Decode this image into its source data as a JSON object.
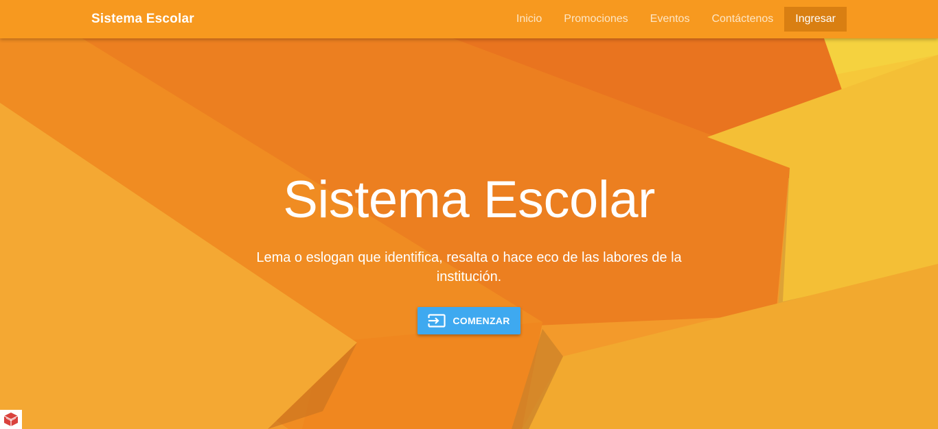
{
  "navbar": {
    "brand": "Sistema Escolar",
    "items": [
      {
        "label": "Inicio"
      },
      {
        "label": "Promociones"
      },
      {
        "label": "Eventos"
      },
      {
        "label": "Contáctenos"
      },
      {
        "label": "Ingresar",
        "active": true
      }
    ]
  },
  "hero": {
    "title": "Sistema Escolar",
    "subtitle": "Lema o eslogan que identifica, resalta o hace eco de las labores de la institución.",
    "cta_label": "COMENZAR",
    "cta_icon": "enter-icon"
  },
  "colors": {
    "navbar": "#f7991f",
    "active_nav": "#d97f12",
    "cta": "#3ea9f0",
    "background": "#f29a2a"
  },
  "corner_widget": {
    "icon": "cube-logo-icon"
  }
}
